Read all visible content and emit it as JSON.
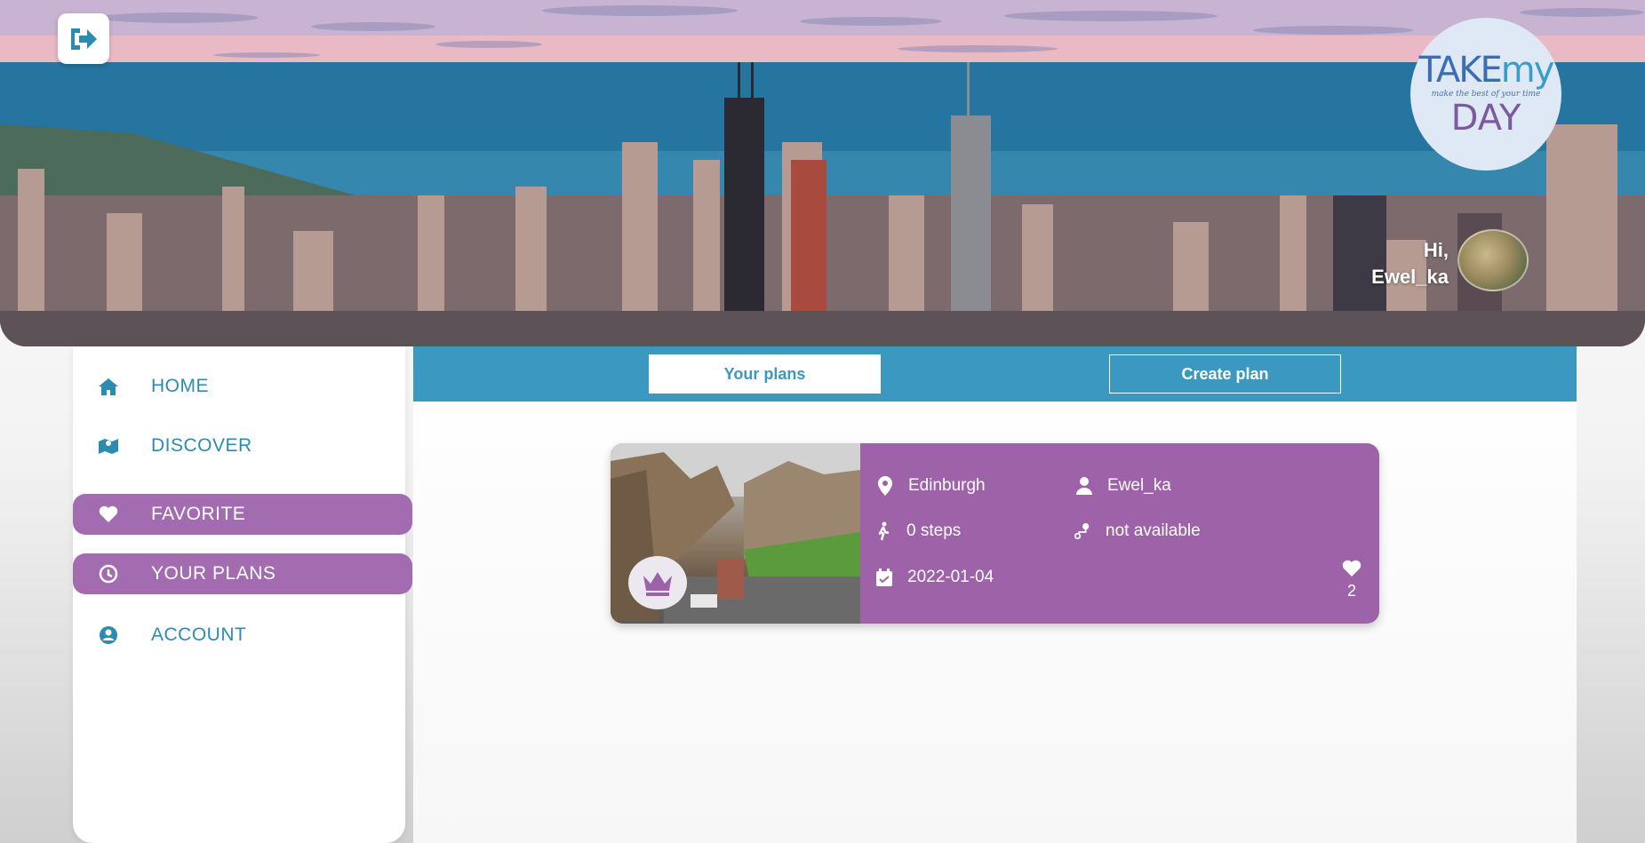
{
  "header": {
    "logout_icon": "logout-icon",
    "logo": {
      "line1_a": "TAKE",
      "line1_b": "my",
      "tagline": "make the best of your time",
      "line2": "DAY"
    },
    "greeting_hi": "Hi,",
    "greeting_user": "Ewel_ka"
  },
  "sidebar": {
    "items": [
      {
        "label": "HOME",
        "icon": "home-icon",
        "active": false
      },
      {
        "label": "DISCOVER",
        "icon": "map-icon",
        "active": false
      },
      {
        "label": "FAVORITE",
        "icon": "heart-icon",
        "active": true
      },
      {
        "label": "YOUR PLANS",
        "icon": "clock-icon",
        "active": true
      },
      {
        "label": "ACCOUNT",
        "icon": "user-circle-icon",
        "active": false
      }
    ]
  },
  "tabs": {
    "your_plans": "Your plans",
    "create_plan": "Create plan"
  },
  "plan_card": {
    "city": "Edinburgh",
    "author": "Ewel_ka",
    "steps": "0 steps",
    "route": "not available",
    "date": "2022-01-04",
    "likes": "2",
    "badge_icon": "crown-icon"
  },
  "colors": {
    "accent_blue": "#3b98c0",
    "accent_purple": "#a46cb0",
    "card_purple": "#9e62a8"
  }
}
